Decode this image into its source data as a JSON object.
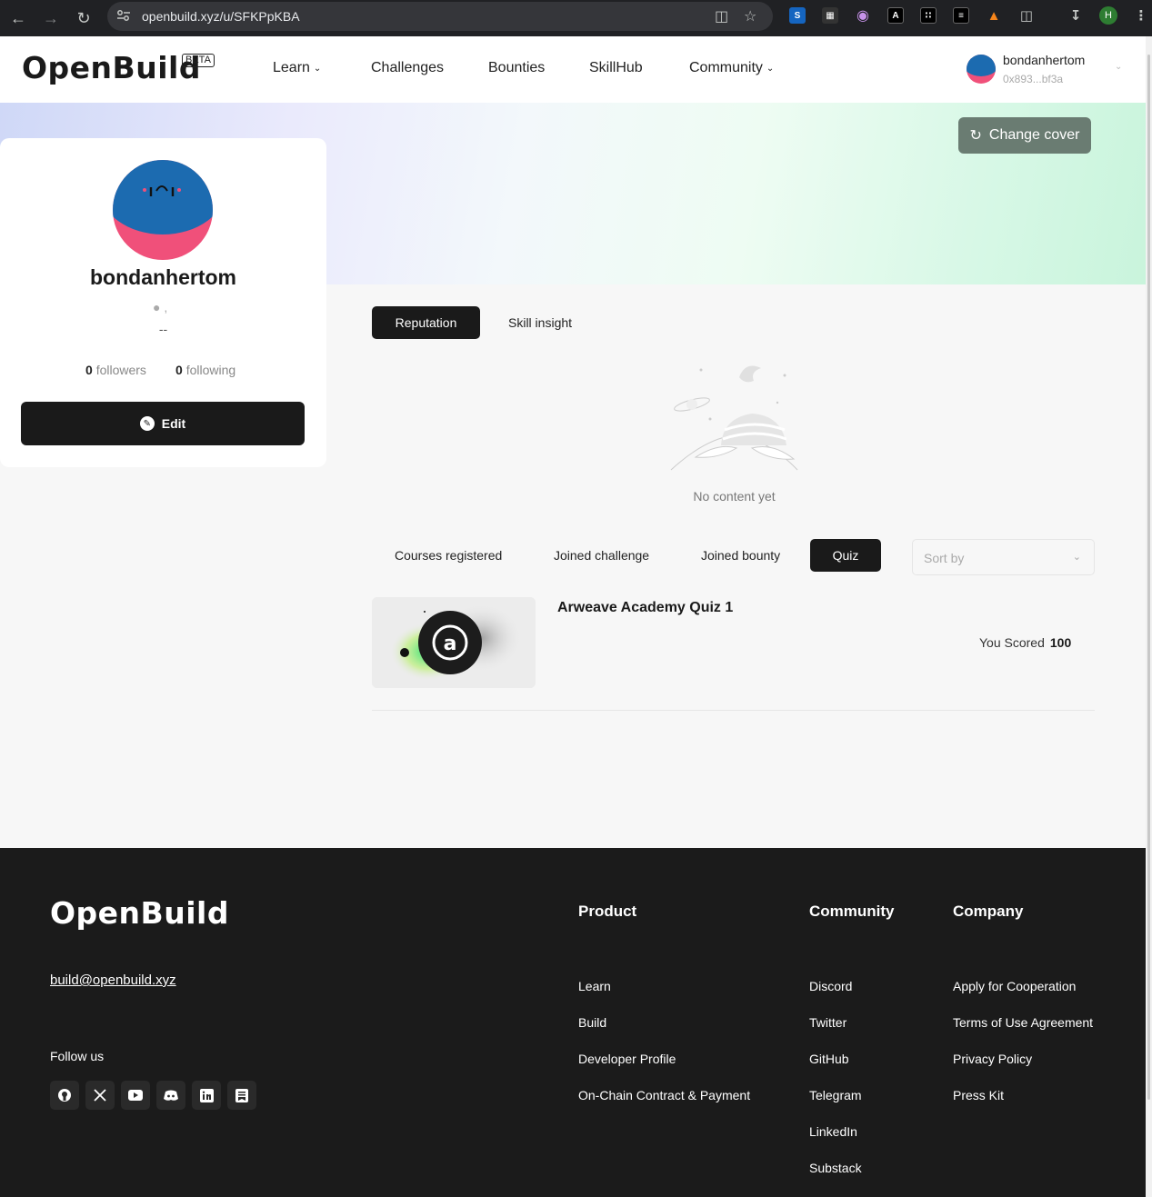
{
  "browser": {
    "url": "openbuild.xyz/u/SFKPpKBA",
    "profile_initial": "H"
  },
  "header": {
    "logo": "OpenBuild",
    "beta": "BETA",
    "nav": [
      {
        "label": "Learn",
        "dropdown": true
      },
      {
        "label": "Challenges",
        "dropdown": false
      },
      {
        "label": "Bounties",
        "dropdown": false
      },
      {
        "label": "SkillHub",
        "dropdown": false
      },
      {
        "label": "Community",
        "dropdown": true
      }
    ],
    "user": {
      "name": "bondanhertom",
      "address": "0x893...bf3a"
    }
  },
  "cover": {
    "change_label": "Change cover"
  },
  "profile": {
    "name": "bondanhertom",
    "location": ",",
    "bio": "--",
    "followers_count": "0",
    "followers_label": "followers",
    "following_count": "0",
    "following_label": "following",
    "edit_label": "Edit"
  },
  "top_tabs": {
    "active": "Reputation",
    "other": "Skill insight"
  },
  "empty": {
    "text": "No content yet"
  },
  "activity_tabs": {
    "items": [
      "Courses registered",
      "Joined challenge",
      "Joined bounty",
      "Quiz"
    ],
    "active": "Quiz",
    "sort_placeholder": "Sort by"
  },
  "quiz_list": [
    {
      "title": "Arweave Academy Quiz 1",
      "score_label": "You Scored",
      "score": "100"
    }
  ],
  "footer": {
    "logo": "OpenBuild",
    "email": "build@openbuild.xyz",
    "follow_label": "Follow us",
    "socials": [
      "github-icon",
      "x-icon",
      "youtube-icon",
      "discord-icon",
      "linkedin-icon",
      "substack-icon"
    ],
    "columns": [
      {
        "title": "Product",
        "links": [
          "Learn",
          "Build",
          "Developer Profile",
          "On-Chain Contract & Payment"
        ]
      },
      {
        "title": "Community",
        "links": [
          "Discord",
          "Twitter",
          "GitHub",
          "Telegram",
          "LinkedIn",
          "Substack"
        ]
      },
      {
        "title": "Company",
        "links": [
          "Apply for Cooperation",
          "Terms of Use Agreement",
          "Privacy Policy",
          "Press Kit"
        ]
      }
    ]
  },
  "colors": {
    "accent": "#1a1a1a",
    "footer_bg": "#1b1b1b",
    "avatar_top": "#1c6bb0",
    "avatar_bottom": "#f0507a",
    "logo_green": "#1ed67f"
  }
}
